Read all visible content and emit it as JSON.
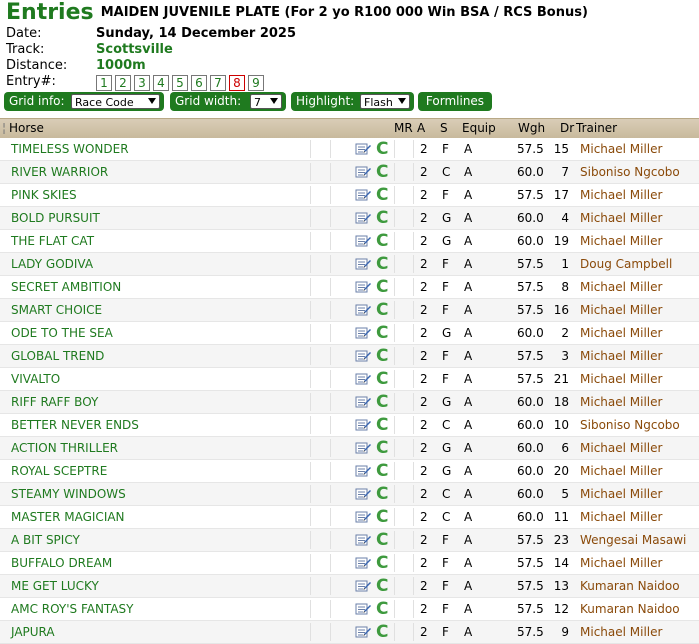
{
  "header": {
    "title": "Entries",
    "race_name": "MAIDEN JUVENILE PLATE (For 2 yo R100 000 Win BSA / RCS Bonus)"
  },
  "info": {
    "date_label": "Date:",
    "date_value": "Sunday, 14 December 2025",
    "track_label": "Track:",
    "track_value": "Scottsville",
    "distance_label": "Distance:",
    "distance_value": "1000m",
    "entry_label": "Entry#:",
    "entries": [
      "1",
      "2",
      "3",
      "4",
      "5",
      "6",
      "7",
      "8",
      "9"
    ],
    "selected_entry": "8"
  },
  "controls": {
    "grid_info_label": "Grid info:",
    "grid_info_value": "Race Code",
    "grid_width_label": "Grid width:",
    "grid_width_value": "7",
    "highlight_label": "Highlight:",
    "highlight_value": "Flash",
    "formlines_label": "Formlines"
  },
  "table": {
    "headers": {
      "horse": "Horse",
      "mr": "MR",
      "a": "A",
      "s": "S",
      "equip": "Equip",
      "wgh": "Wgh",
      "dr": "Dr",
      "trainer": "Trainer"
    },
    "rows": [
      {
        "horse": "TIMELESS WONDER",
        "mr": "",
        "a": "2",
        "s": "F",
        "equip": "A",
        "wgh": "57.5",
        "dr": "15",
        "trainer": "Michael Miller"
      },
      {
        "horse": "RIVER WARRIOR",
        "mr": "",
        "a": "2",
        "s": "C",
        "equip": "A",
        "wgh": "60.0",
        "dr": "7",
        "trainer": "Siboniso Ngcobo"
      },
      {
        "horse": "PINK SKIES",
        "mr": "",
        "a": "2",
        "s": "F",
        "equip": "A",
        "wgh": "57.5",
        "dr": "17",
        "trainer": "Michael Miller"
      },
      {
        "horse": "BOLD PURSUIT",
        "mr": "",
        "a": "2",
        "s": "G",
        "equip": "A",
        "wgh": "60.0",
        "dr": "4",
        "trainer": "Michael Miller"
      },
      {
        "horse": "THE FLAT CAT",
        "mr": "",
        "a": "2",
        "s": "G",
        "equip": "A",
        "wgh": "60.0",
        "dr": "19",
        "trainer": "Michael Miller"
      },
      {
        "horse": "LADY GODIVA",
        "mr": "",
        "a": "2",
        "s": "F",
        "equip": "A",
        "wgh": "57.5",
        "dr": "1",
        "trainer": "Doug Campbell"
      },
      {
        "horse": "SECRET AMBITION",
        "mr": "",
        "a": "2",
        "s": "F",
        "equip": "A",
        "wgh": "57.5",
        "dr": "8",
        "trainer": "Michael Miller"
      },
      {
        "horse": "SMART CHOICE",
        "mr": "",
        "a": "2",
        "s": "F",
        "equip": "A",
        "wgh": "57.5",
        "dr": "16",
        "trainer": "Michael Miller"
      },
      {
        "horse": "ODE TO THE SEA",
        "mr": "",
        "a": "2",
        "s": "G",
        "equip": "A",
        "wgh": "60.0",
        "dr": "2",
        "trainer": "Michael Miller"
      },
      {
        "horse": "GLOBAL TREND",
        "mr": "",
        "a": "2",
        "s": "F",
        "equip": "A",
        "wgh": "57.5",
        "dr": "3",
        "trainer": "Michael Miller"
      },
      {
        "horse": "VIVALTO",
        "mr": "",
        "a": "2",
        "s": "F",
        "equip": "A",
        "wgh": "57.5",
        "dr": "21",
        "trainer": "Michael Miller"
      },
      {
        "horse": "RIFF RAFF BOY",
        "mr": "",
        "a": "2",
        "s": "G",
        "equip": "A",
        "wgh": "60.0",
        "dr": "18",
        "trainer": "Michael Miller"
      },
      {
        "horse": "BETTER NEVER ENDS",
        "mr": "",
        "a": "2",
        "s": "C",
        "equip": "A",
        "wgh": "60.0",
        "dr": "10",
        "trainer": "Siboniso Ngcobo"
      },
      {
        "horse": "ACTION THRILLER",
        "mr": "",
        "a": "2",
        "s": "G",
        "equip": "A",
        "wgh": "60.0",
        "dr": "6",
        "trainer": "Michael Miller"
      },
      {
        "horse": "ROYAL SCEPTRE",
        "mr": "",
        "a": "2",
        "s": "G",
        "equip": "A",
        "wgh": "60.0",
        "dr": "20",
        "trainer": "Michael Miller"
      },
      {
        "horse": "STEAMY WINDOWS",
        "mr": "",
        "a": "2",
        "s": "C",
        "equip": "A",
        "wgh": "60.0",
        "dr": "5",
        "trainer": "Michael Miller"
      },
      {
        "horse": "MASTER MAGICIAN",
        "mr": "",
        "a": "2",
        "s": "C",
        "equip": "A",
        "wgh": "60.0",
        "dr": "11",
        "trainer": "Michael Miller"
      },
      {
        "horse": "A BIT SPICY",
        "mr": "",
        "a": "2",
        "s": "F",
        "equip": "A",
        "wgh": "57.5",
        "dr": "23",
        "trainer": "Wengesai Masawi"
      },
      {
        "horse": "BUFFALO DREAM",
        "mr": "",
        "a": "2",
        "s": "F",
        "equip": "A",
        "wgh": "57.5",
        "dr": "14",
        "trainer": "Michael Miller"
      },
      {
        "horse": "ME GET LUCKY",
        "mr": "",
        "a": "2",
        "s": "F",
        "equip": "A",
        "wgh": "57.5",
        "dr": "13",
        "trainer": "Kumaran Naidoo"
      },
      {
        "horse": "AMC ROY'S FANTASY",
        "mr": "",
        "a": "2",
        "s": "F",
        "equip": "A",
        "wgh": "57.5",
        "dr": "12",
        "trainer": "Kumaran Naidoo"
      },
      {
        "horse": "JAPURA",
        "mr": "",
        "a": "2",
        "s": "F",
        "equip": "A",
        "wgh": "57.5",
        "dr": "9",
        "trainer": "Michael Miller"
      }
    ],
    "row_icons": [
      "form-guide-icon",
      "comment-c-icon"
    ],
    "row_comment_letter": "C"
  },
  "colors": {
    "accent_green": "#1f7a1f",
    "trainer_brown": "#8a4a0a",
    "header_tan": "#d0c3a8",
    "selected_entry_red": "#cc0000"
  }
}
